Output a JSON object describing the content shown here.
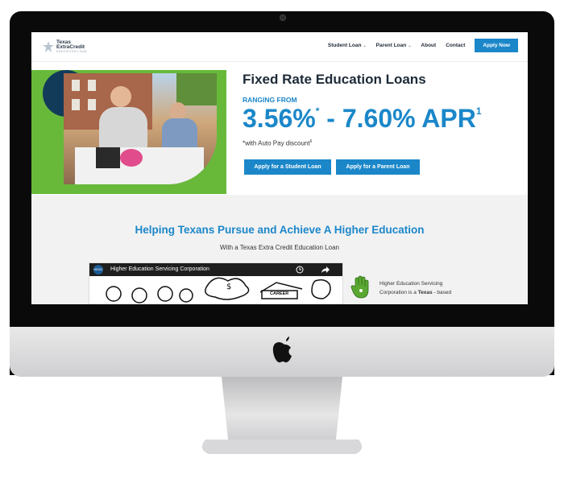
{
  "header": {
    "logo_line1": "Texas",
    "logo_line2": "ExtraCredit",
    "logo_tagline": "EDUCATION LOAN",
    "nav": [
      {
        "label": "Student Loan",
        "has_caret": true
      },
      {
        "label": "Parent Loan",
        "has_caret": true
      },
      {
        "label": "About",
        "has_caret": false
      },
      {
        "label": "Contact",
        "has_caret": false
      }
    ],
    "apply_button": "Apply Now",
    "caret_icon": "chevron-down-icon"
  },
  "hero": {
    "title": "Fixed Rate Education Loans",
    "ranging": "RANGING FROM",
    "rate_low": "3.56%",
    "rate_low_sup": "*",
    "rate_separator": " - ",
    "rate_high": "7.60% APR",
    "rate_high_sup": "1",
    "autopay": "*with Auto Pay discount",
    "autopay_sup": "6",
    "student_button": "Apply for a Student Loan",
    "parent_button": "Apply for a Parent Loan"
  },
  "section": {
    "title": "Helping Texans Pursue and Achieve A Higher Education",
    "subtitle": "With a Texas Extra Credit Education Loan",
    "video_badge": "HESC",
    "video_title": "Higher Education Servicing Corporation",
    "career_sign": "CAREER",
    "side_text_1": "Higher Education Servicing",
    "side_text_2": "Corporation is a ",
    "side_text_bold": "Texas",
    "side_text_3": " - based"
  },
  "colors": {
    "accent": "#1b87c9",
    "green": "#68b93a",
    "navy": "#123b5a",
    "dark_text": "#1d2a38"
  }
}
